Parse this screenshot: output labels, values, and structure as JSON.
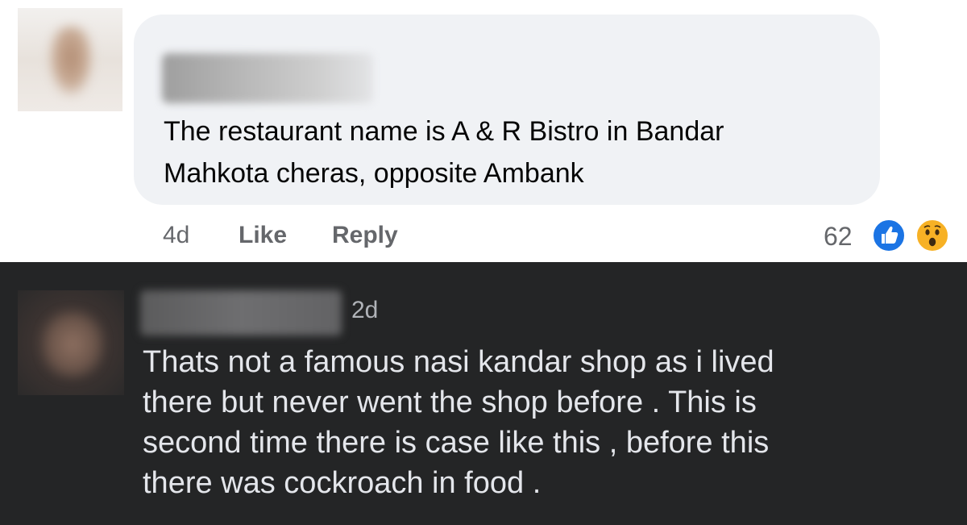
{
  "comment_light": {
    "text_line1": "The restaurant name is A & R Bistro in Bandar",
    "text_line2": "Mahkota cheras, opposite Ambank",
    "time": "4d",
    "like_label": "Like",
    "reply_label": "Reply",
    "reaction_count": "62",
    "reactions": [
      "like-icon",
      "wow-icon"
    ]
  },
  "comment_dark": {
    "time": "2d",
    "text_line1": "Thats not a famous nasi kandar shop as i lived",
    "text_line2": "there but never went the shop before . This is",
    "text_line3": "second time there is case like this , before this",
    "text_line4": "there was cockroach in food ."
  },
  "colors": {
    "light_bubble": "#f0f2f5",
    "dark_background": "#242526",
    "like_blue": "#1b74e4",
    "wow_yellow": "#f7b125",
    "meta_gray": "#65676b"
  }
}
